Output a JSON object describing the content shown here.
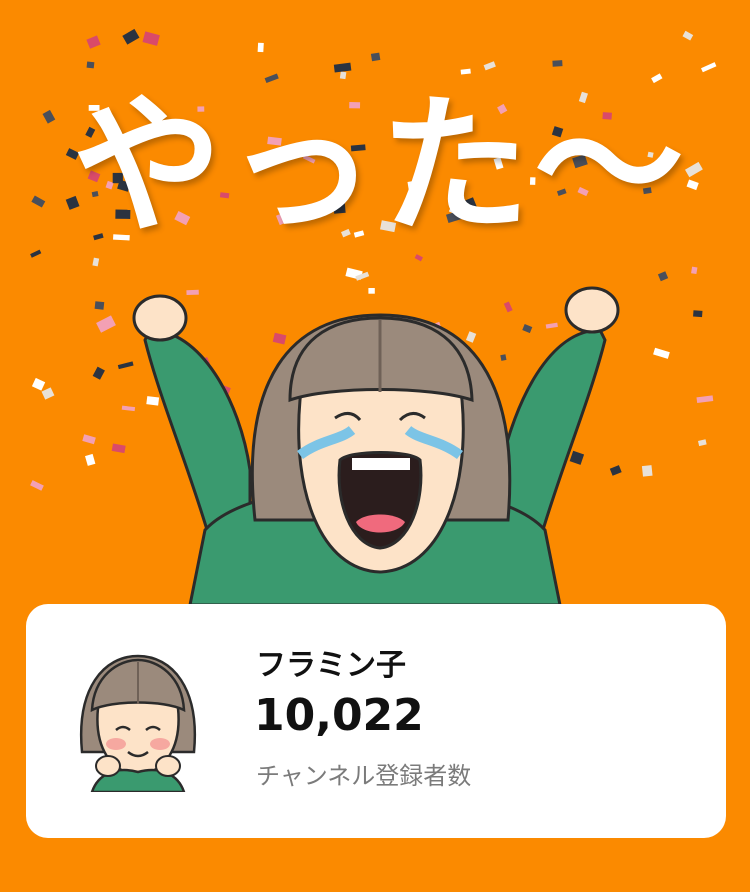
{
  "celebration": {
    "headline": "やった〜",
    "background_color": "#fb8a00"
  },
  "channel_card": {
    "name": "フラミン子",
    "subscriber_count": "10,022",
    "subscriber_label": "チャンネル登録者数"
  }
}
